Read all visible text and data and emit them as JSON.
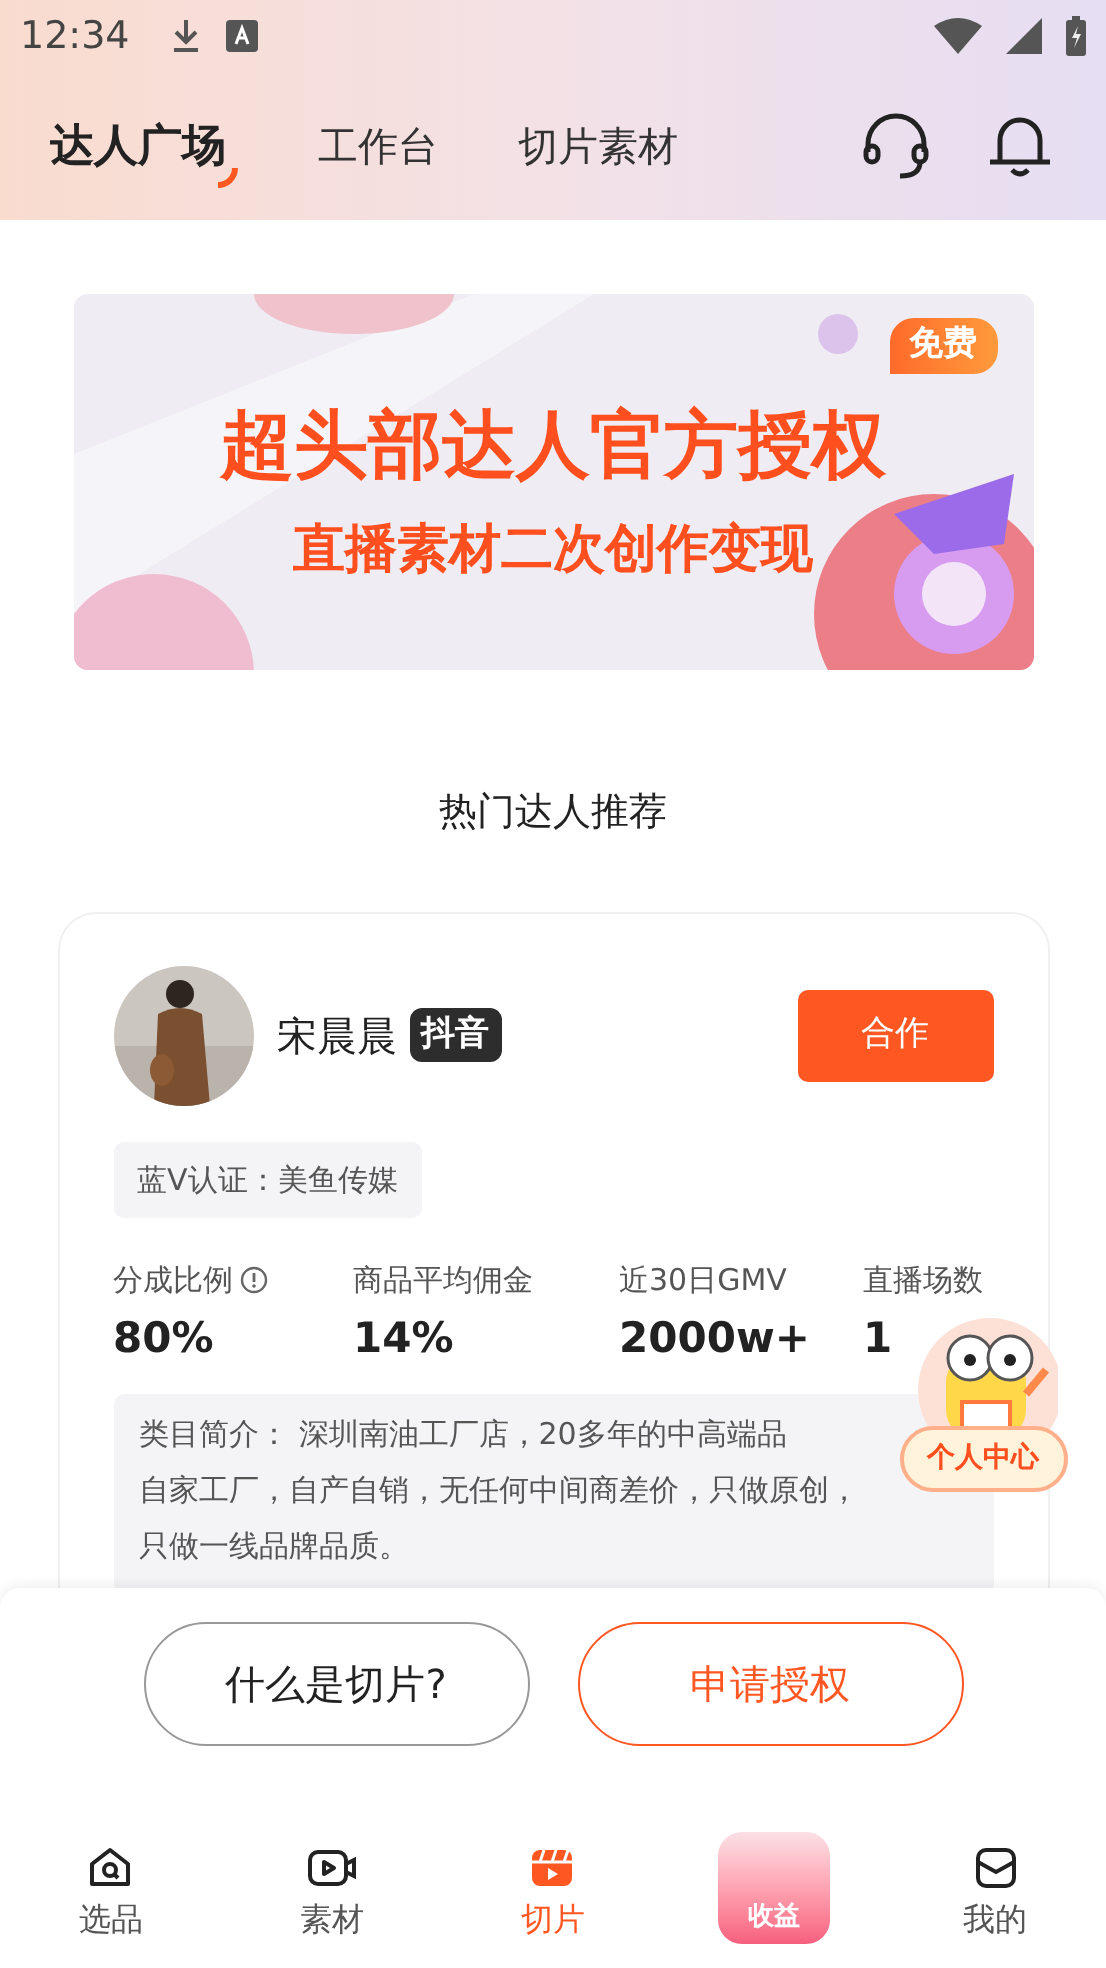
{
  "status_bar": {
    "time": "12:34"
  },
  "header": {
    "tabs": [
      {
        "label": "达人广场",
        "selected": true
      },
      {
        "label": "工作台",
        "selected": false
      },
      {
        "label": "切片素材",
        "selected": false
      }
    ]
  },
  "banner": {
    "headline": "超头部达人官方授权",
    "subline": "直播素材二次创作变现",
    "badge": "免费"
  },
  "section_title": "热门达人推荐",
  "creator": {
    "name": "宋晨晨",
    "platform": "抖音",
    "action": "合作",
    "verification": "蓝V认证：美鱼传媒",
    "stats": [
      {
        "label": "分成比例",
        "info": true,
        "value": "80%"
      },
      {
        "label": "商品平均佣金",
        "info": false,
        "value": "14%"
      },
      {
        "label": "近30日GMV",
        "info": false,
        "value": "2000w+"
      },
      {
        "label": "直播场数",
        "info": false,
        "value": "1"
      }
    ],
    "description": [
      "类目简介： 深圳南油工厂店，20多年的中高端品",
      "自家工厂，自产自销，无任何中间商差价，只做原创，",
      "只做一线品牌品质。"
    ]
  },
  "floating_button": {
    "label": "个人中心"
  },
  "actions": [
    {
      "label": "什么是切片?",
      "kind": "secondary"
    },
    {
      "label": "申请授权",
      "kind": "primary"
    }
  ],
  "bottom_nav": [
    {
      "label": "选品",
      "kind": "select",
      "selected": false
    },
    {
      "label": "素材",
      "kind": "material",
      "selected": false
    },
    {
      "label": "切片",
      "kind": "clip",
      "selected": true
    },
    {
      "label": "收益",
      "kind": "earnings",
      "selected": false
    },
    {
      "label": "我的",
      "kind": "mine",
      "selected": false
    }
  ]
}
